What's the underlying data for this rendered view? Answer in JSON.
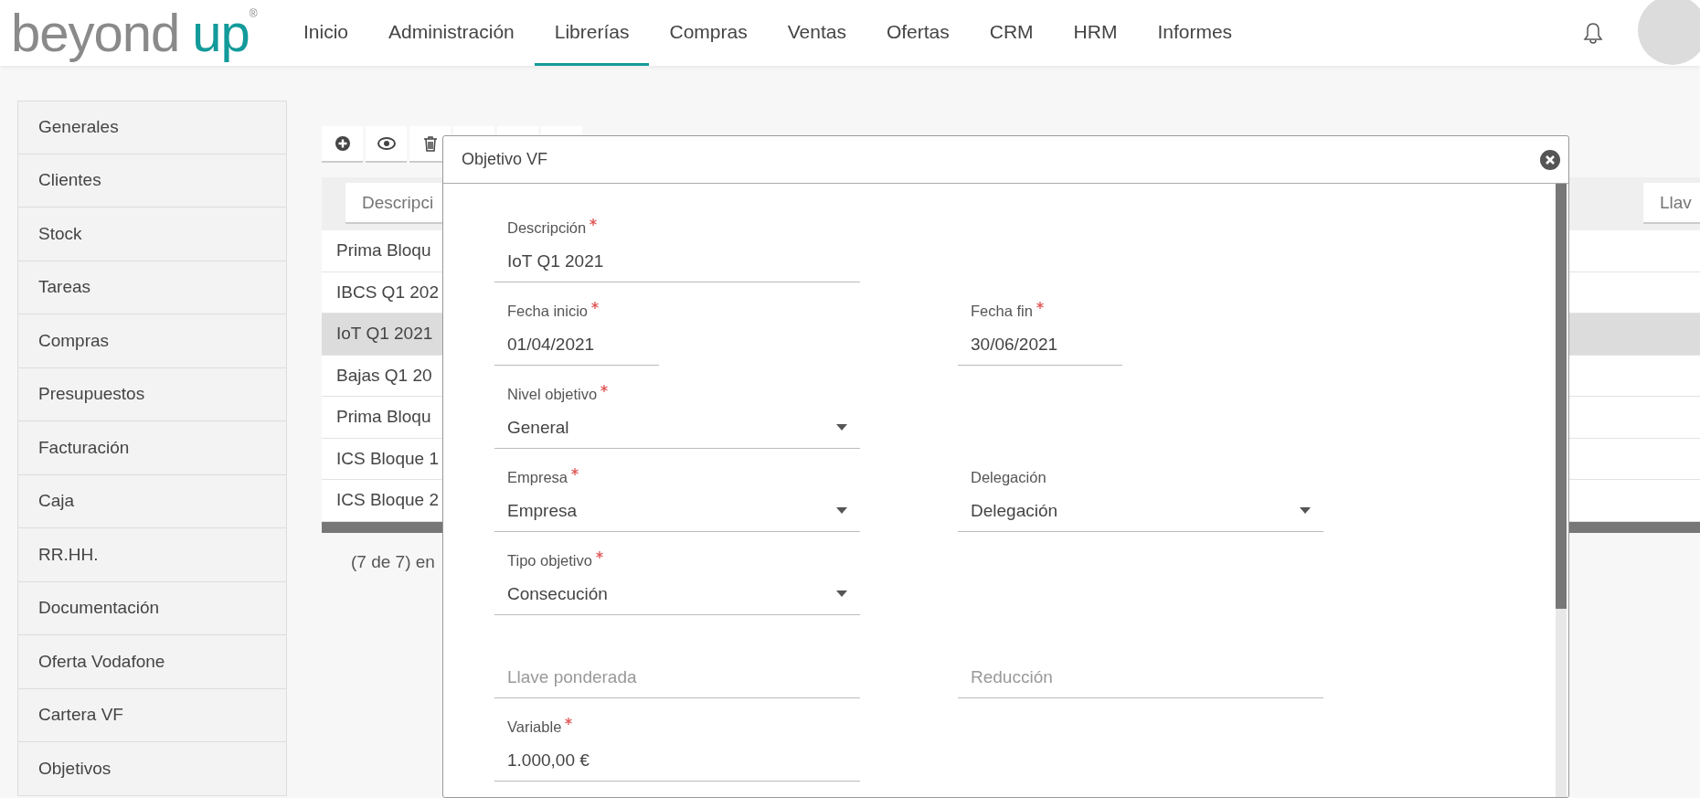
{
  "brand": {
    "word1": "beyond",
    "word2": "up",
    "mark": "®"
  },
  "nav": [
    {
      "label": "Inicio",
      "selected": false
    },
    {
      "label": "Administración",
      "selected": false
    },
    {
      "label": "Librerías",
      "selected": true
    },
    {
      "label": "Compras",
      "selected": false
    },
    {
      "label": "Ventas",
      "selected": false
    },
    {
      "label": "Ofertas",
      "selected": false
    },
    {
      "label": "CRM",
      "selected": false
    },
    {
      "label": "HRM",
      "selected": false
    },
    {
      "label": "Informes",
      "selected": false
    }
  ],
  "sidebar": {
    "items": [
      "Generales",
      "Clientes",
      "Stock",
      "Tareas",
      "Compras",
      "Presupuestos",
      "Facturación",
      "Caja",
      "RR.HH.",
      "Documentación",
      "Oferta Vodafone",
      "Cartera VF",
      "Objetivos"
    ]
  },
  "toolbar": [
    {
      "kind": "add"
    },
    {
      "kind": "view"
    },
    {
      "kind": "delete"
    },
    {
      "kind": "blank"
    },
    {
      "kind": "blank"
    },
    {
      "kind": "blank"
    }
  ],
  "table": {
    "filters": [
      {
        "placeholder": "Descripci"
      },
      {
        "placeholder": "Llav"
      }
    ],
    "rows": [
      {
        "cell": "Prima Bloqu",
        "selected": false
      },
      {
        "cell": "IBCS Q1 202",
        "selected": false
      },
      {
        "cell": "IoT Q1 2021",
        "selected": true
      },
      {
        "cell": "Bajas Q1 20",
        "selected": false
      },
      {
        "cell": "Prima Bloqu",
        "selected": false
      },
      {
        "cell": "ICS Bloque 1",
        "selected": false
      },
      {
        "cell": "ICS Bloque 2",
        "selected": false
      }
    ],
    "pager": "(7 de 7) en"
  },
  "modal": {
    "title": "Objetivo VF",
    "rows": [
      [
        {
          "kind": "text",
          "label": "Descripción",
          "required": true,
          "value": "IoT Q1 2021"
        }
      ],
      [
        {
          "kind": "date",
          "label": "Fecha inicio",
          "required": true,
          "value": "01/04/2021"
        },
        {
          "kind": "date",
          "label": "Fecha fin",
          "required": true,
          "value": "30/06/2021"
        }
      ],
      [
        {
          "kind": "select",
          "label": "Nivel objetivo",
          "required": true,
          "value": "General"
        }
      ],
      [
        {
          "kind": "select",
          "label": "Empresa",
          "required": true,
          "value": "Empresa"
        },
        {
          "kind": "select",
          "label": "Delegación",
          "required": false,
          "value": "Delegación"
        }
      ],
      [
        {
          "kind": "select",
          "label": "Tipo objetivo",
          "required": true,
          "value": "Consecución"
        }
      ],
      [
        {
          "kind": "text",
          "placeholder": "Llave ponderada"
        },
        {
          "kind": "text",
          "placeholder": "Reducción"
        }
      ],
      [
        {
          "kind": "text",
          "label": "Variable",
          "required": true,
          "value": "1.000,00 €"
        }
      ]
    ]
  }
}
